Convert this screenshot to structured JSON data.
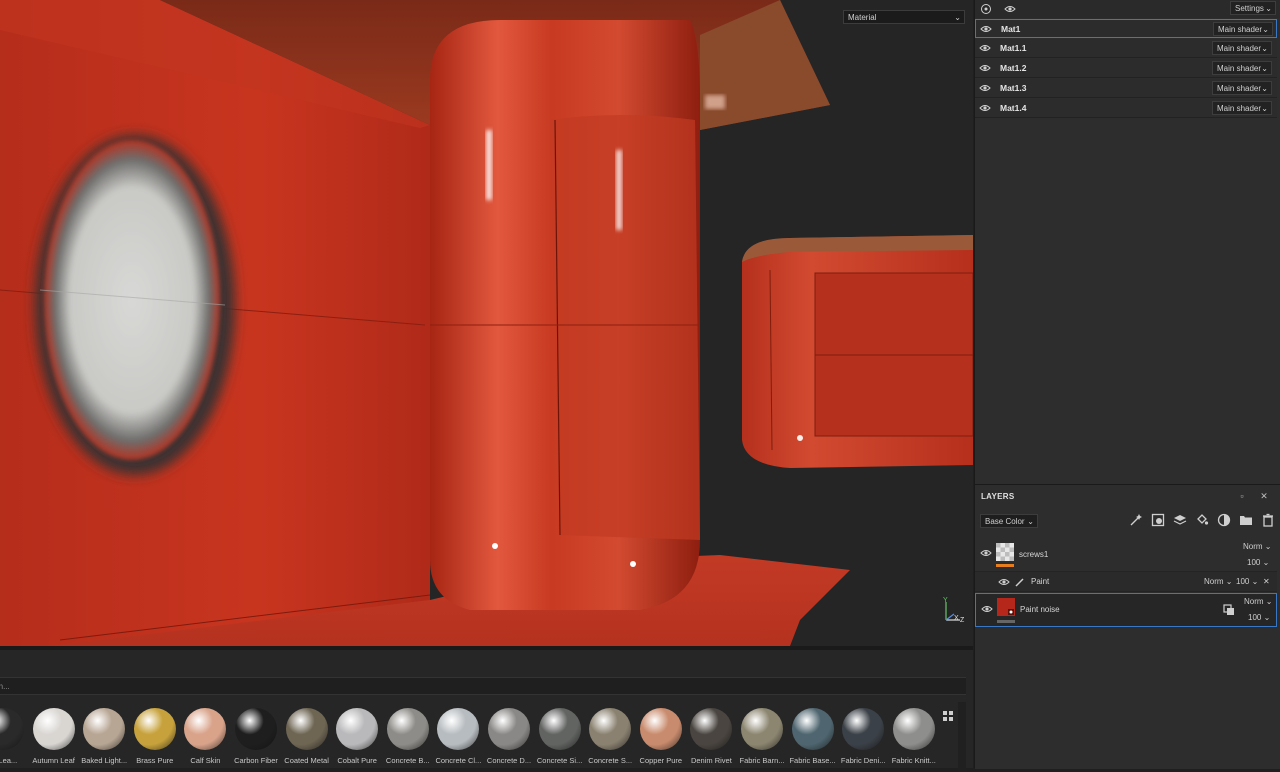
{
  "viewport": {
    "display_select": "Material",
    "axis": {
      "y": "Y",
      "x": "X",
      "z": "Z"
    }
  },
  "texture_sets": {
    "settings_label": "Settings",
    "rows": [
      {
        "name": "Mat1",
        "shader": "Main shader",
        "selected": true
      },
      {
        "name": "Mat1.1",
        "shader": "Main shader",
        "selected": false
      },
      {
        "name": "Mat1.2",
        "shader": "Main shader",
        "selected": false
      },
      {
        "name": "Mat1.3",
        "shader": "Main shader",
        "selected": false
      },
      {
        "name": "Mat1.4",
        "shader": "Main shader",
        "selected": false
      }
    ]
  },
  "layers": {
    "title": "LAYERS",
    "channel": "Base Color",
    "items": [
      {
        "name": "screws1",
        "blend": "Norm",
        "opacity": "100"
      },
      {
        "name": "Paint",
        "blend": "Norm",
        "opacity": "100"
      },
      {
        "name": "Paint noise",
        "blend": "Norm",
        "opacity": "100"
      }
    ]
  },
  "shelf": {
    "search_value": "rch...",
    "materials": [
      {
        "label": "ial Lea...",
        "color": "#2a2a2a"
      },
      {
        "label": "Autumn Leaf",
        "color": "#d9d6d2"
      },
      {
        "label": "Baked Light...",
        "color": "#b8a694"
      },
      {
        "label": "Brass Pure",
        "color": "#c7a23c"
      },
      {
        "label": "Calf Skin",
        "color": "#d9a38a"
      },
      {
        "label": "Carbon Fiber",
        "color": "#1e1e1e"
      },
      {
        "label": "Coated Metal",
        "color": "#6e6553"
      },
      {
        "label": "Cobalt Pure",
        "color": "#b9b9bb"
      },
      {
        "label": "Concrete B...",
        "color": "#8e8c88"
      },
      {
        "label": "Concrete Cl...",
        "color": "#b7bcc0"
      },
      {
        "label": "Concrete D...",
        "color": "#8a8886"
      },
      {
        "label": "Concrete Si...",
        "color": "#626462"
      },
      {
        "label": "Concrete S...",
        "color": "#8a8170"
      },
      {
        "label": "Copper Pure",
        "color": "#c98b6d"
      },
      {
        "label": "Denim Rivet",
        "color": "#4a4540"
      },
      {
        "label": "Fabric Barn...",
        "color": "#8c8670"
      },
      {
        "label": "Fabric Base...",
        "color": "#4f6670"
      },
      {
        "label": "Fabric Deni...",
        "color": "#3b4148"
      },
      {
        "label": "Fabric Knitt...",
        "color": "#8e8e8c"
      }
    ]
  }
}
